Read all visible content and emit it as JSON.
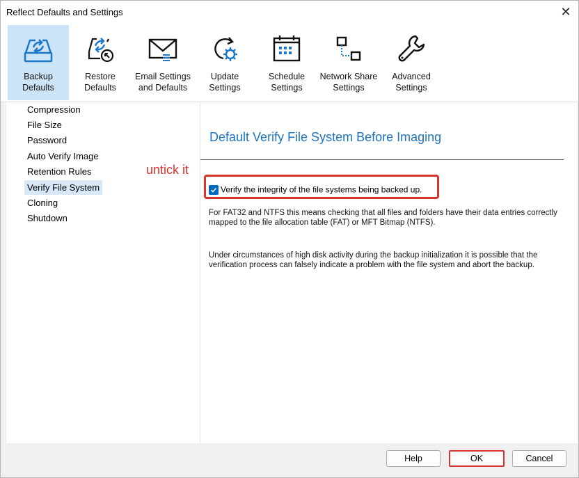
{
  "window": {
    "title": "Reflect Defaults and Settings",
    "close_glyph": "✕"
  },
  "toolbar": {
    "items": [
      {
        "label": "Backup\nDefaults",
        "icon": "backup-drive-icon",
        "selected": true
      },
      {
        "label": "Restore\nDefaults",
        "icon": "restore-icon",
        "selected": false
      },
      {
        "label": "Email Settings\nand Defaults",
        "icon": "envelope-icon",
        "selected": false
      },
      {
        "label": "Update\nSettings",
        "icon": "update-gear-icon",
        "selected": false
      },
      {
        "label": "Schedule\nSettings",
        "icon": "calendar-icon",
        "selected": false
      },
      {
        "label": "Network Share\nSettings",
        "icon": "network-icon",
        "selected": false
      },
      {
        "label": "Advanced\nSettings",
        "icon": "wrench-icon",
        "selected": false
      }
    ]
  },
  "sidebar": {
    "items": [
      {
        "label": "Compression",
        "selected": false
      },
      {
        "label": "File Size",
        "selected": false
      },
      {
        "label": "Password",
        "selected": false
      },
      {
        "label": "Auto Verify Image",
        "selected": false
      },
      {
        "label": "Retention Rules",
        "selected": false
      },
      {
        "label": "Verify File System",
        "selected": true
      },
      {
        "label": "Cloning",
        "selected": false
      },
      {
        "label": "Shutdown",
        "selected": false
      }
    ]
  },
  "content": {
    "title": "Default Verify File System Before Imaging",
    "checkbox_label": "Verify the integrity of the file systems being backed up.",
    "checkbox_checked": true,
    "para1": "For FAT32 and NTFS this means checking that all files and folders have their data entries correctly mapped to the file allocation table (FAT) or MFT Bitmap (NTFS).",
    "para2": "Under circumstances of high disk activity during the backup initialization it is possible that the verification process can falsely indicate a problem with the file system and abort the backup."
  },
  "annotation": {
    "text": "untick it",
    "color": "#e0302a"
  },
  "footer": {
    "help_label": "Help",
    "ok_label": "OK",
    "cancel_label": "Cancel"
  },
  "colors": {
    "accent": "#1e73be",
    "selection": "#cce4f7",
    "checkbox": "#0067c0",
    "highlight": "#d9312b"
  }
}
